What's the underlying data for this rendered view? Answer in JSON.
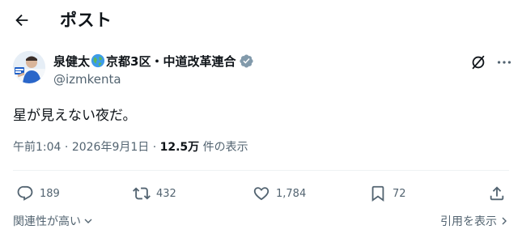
{
  "header": {
    "back_icon": "arrow-left-icon",
    "title": "ポスト"
  },
  "author": {
    "name_part1": "泉健太",
    "name_part2": "京都3区・中道改革連合",
    "emoji_icon": "globe-icon",
    "verified_icon": "verified-badge-icon",
    "verified_color": "#829aab",
    "handle": "@izmkenta"
  },
  "toolbar": {
    "grok_icon": "grok-icon",
    "more_icon": "more-dots-icon"
  },
  "tweet": {
    "text": "星が見えない夜だ。"
  },
  "meta": {
    "time": "午前1:04",
    "separator": "·",
    "date": "2026年9月1日",
    "views_count": "12.5万",
    "views_label": "件の表示"
  },
  "actions": {
    "reply_count": "189",
    "repost_count": "432",
    "like_count": "1,784",
    "bookmark_count": "72"
  },
  "footer": {
    "sort_label": "関連性が高い",
    "quotes_label": "引用を表示"
  },
  "colors": {
    "text": "#0f1419",
    "secondary": "#536471",
    "divider": "#eff3f4"
  }
}
